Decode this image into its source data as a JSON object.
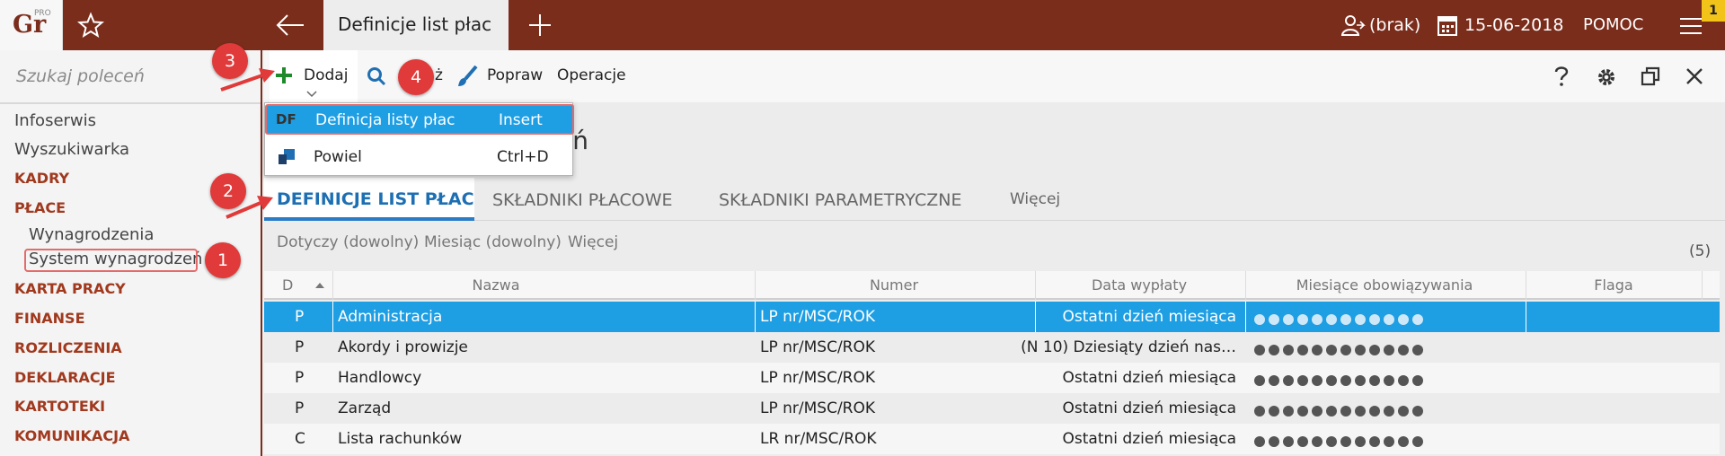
{
  "app": {
    "logo_text": "Gr",
    "logo_sup": "PRO",
    "active_tab": "Definicje list płac",
    "notification_count": "1"
  },
  "topbar_right": {
    "user": "(brak)",
    "date": "15-06-2018",
    "help": "POMOC"
  },
  "sidebar": {
    "search_placeholder": "Szukaj poleceń",
    "items": [
      {
        "label": "Infoserwis",
        "kind": "link"
      },
      {
        "label": "Wyszukiwarka",
        "kind": "link"
      },
      {
        "label": "KADRY",
        "kind": "cat"
      },
      {
        "label": "PŁACE",
        "kind": "cat"
      },
      {
        "label": "Wynagrodzenia",
        "kind": "sub"
      },
      {
        "label": "System wynagrodzeń",
        "kind": "sub"
      },
      {
        "label": "KARTA PRACY",
        "kind": "cat"
      },
      {
        "label": "FINANSE",
        "kind": "cat"
      },
      {
        "label": "ROZLICZENIA",
        "kind": "cat"
      },
      {
        "label": "DEKLARACJE",
        "kind": "cat"
      },
      {
        "label": "KARTOTEKI",
        "kind": "cat"
      },
      {
        "label": "KOMUNIKACJA",
        "kind": "cat"
      }
    ]
  },
  "toolbar": {
    "add": "Dodaj",
    "show": "Pokaż",
    "edit": "Popraw",
    "operations": "Operacje"
  },
  "dropdown": {
    "items": [
      {
        "icon": "DF",
        "label": "Definicja listy płac",
        "shortcut": "Insert"
      },
      {
        "icon": "",
        "label": "Powiel",
        "shortcut": "Ctrl+D"
      }
    ]
  },
  "heading_partial": "eń",
  "tabs": [
    "DEFINICJE LIST PŁAC",
    "SKŁADNIKI PŁACOWE",
    "SKŁADNIKI PARAMETRYCZNE",
    "Więcej"
  ],
  "filters": [
    "Dotyczy (dowolny)",
    "Miesiąc (dowolny)",
    "Więcej"
  ],
  "count": "(5)",
  "table": {
    "columns": [
      "D",
      "Nazwa",
      "Numer",
      "Data wypłaty",
      "Miesiące obowiązywania",
      "Flaga"
    ],
    "rows": [
      {
        "d": "P",
        "nazwa": "Administracja",
        "numer": "LP nr/MSC/ROK",
        "data": "Ostatni dzień miesiąca",
        "months": 12
      },
      {
        "d": "P",
        "nazwa": "Akordy i prowizje",
        "numer": "LP nr/MSC/ROK",
        "data": "(N 10) Dziesiąty dzień nas…",
        "months": 12
      },
      {
        "d": "P",
        "nazwa": "Handlowcy",
        "numer": "LP nr/MSC/ROK",
        "data": "Ostatni dzień miesiąca",
        "months": 12
      },
      {
        "d": "P",
        "nazwa": "Zarząd",
        "numer": "LP nr/MSC/ROK",
        "data": "Ostatni dzień miesiąca",
        "months": 12
      },
      {
        "d": "C",
        "nazwa": "Lista rachunków",
        "numer": "LR nr/MSC/ROK",
        "data": "Ostatni dzień miesiąca",
        "months": 12
      }
    ]
  },
  "annotations": [
    "1",
    "2",
    "3",
    "4"
  ],
  "colors": {
    "brand": "#7b2d1c",
    "accent": "#1e9ee3",
    "annotation": "#e03a3a",
    "category": "#a0391e"
  }
}
